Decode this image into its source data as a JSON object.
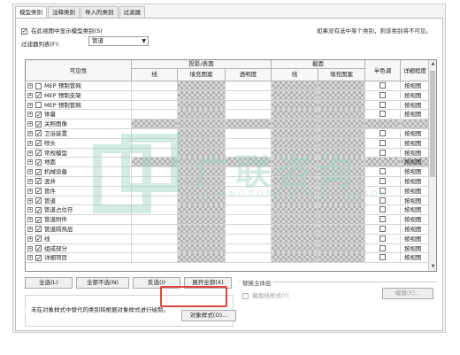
{
  "tabs": [
    {
      "label": "模型类别",
      "active": true
    },
    {
      "label": "注释类别",
      "active": false
    },
    {
      "label": "导入的类别",
      "active": false
    },
    {
      "label": "过滤器",
      "active": false
    }
  ],
  "show_all_checkbox": {
    "label": "在此视图中显示模型类别(S)",
    "checked": true
  },
  "note": "如果没有选中某个类别，则该类别将不可见。",
  "filter": {
    "label": "过滤器列表(F):",
    "value": "管道"
  },
  "table": {
    "headers": {
      "visibility": "可见性",
      "projection_surface": "投影/表面",
      "cut": "截面",
      "halftone": "半色调",
      "detail_level": "详细程度",
      "lines": "线",
      "fill_pattern": "填充图案",
      "transparency": "透明度",
      "cut_lines": "线",
      "cut_fill_pattern": "填充图案"
    },
    "rows": [
      {
        "name": "MEP 预制管网",
        "checked": false,
        "patterned": false,
        "detail": "按视图"
      },
      {
        "name": "MEP 预制支架",
        "checked": true,
        "patterned": false,
        "detail": "按视图"
      },
      {
        "name": "MEP 预制管网",
        "checked": false,
        "patterned": false,
        "detail": "按视图"
      },
      {
        "name": "体量",
        "checked": true,
        "patterned": false,
        "detail": "按视图"
      },
      {
        "name": "关照图像",
        "checked": true,
        "patterned": true,
        "detail": ""
      },
      {
        "name": "卫浴装置",
        "checked": true,
        "patterned": false,
        "detail": "按视图"
      },
      {
        "name": "喷头",
        "checked": true,
        "patterned": false,
        "detail": "按视图"
      },
      {
        "name": "常规模型",
        "checked": true,
        "patterned": false,
        "detail": "按视图"
      },
      {
        "name": "地面",
        "checked": true,
        "patterned": true,
        "detail": "按视图"
      },
      {
        "name": "机械设备",
        "checked": true,
        "patterned": false,
        "detail": "按视图"
      },
      {
        "name": "竖井",
        "checked": true,
        "patterned": false,
        "detail": "按视图"
      },
      {
        "name": "管件",
        "checked": true,
        "patterned": false,
        "detail": "按视图"
      },
      {
        "name": "管道",
        "checked": true,
        "patterned": false,
        "detail": "按视图"
      },
      {
        "name": "管道占位符",
        "checked": true,
        "patterned": false,
        "detail": "按视图"
      },
      {
        "name": "管道附件",
        "checked": true,
        "patterned": false,
        "detail": "按视图"
      },
      {
        "name": "管道隔热层",
        "checked": true,
        "patterned": false,
        "detail": "按视图"
      },
      {
        "name": "线",
        "checked": true,
        "patterned": false,
        "detail": "按视图"
      },
      {
        "name": "组成部分",
        "checked": true,
        "patterned": false,
        "detail": "按视图"
      },
      {
        "name": "详细项目",
        "checked": true,
        "patterned": false,
        "detail": "按视图"
      }
    ]
  },
  "buttons": {
    "select_all": "全选(L)",
    "select_none": "全部不选(N)",
    "invert": "反选(I)",
    "expand_all": "展开全部(X)",
    "object_styles": "对象样式(O)..."
  },
  "override_group": {
    "title": "替换主体层",
    "cut_line_style_label": "截面线样式(Y)",
    "edit_button": "编辑(E)..."
  },
  "bottom_text": "未在对象样式中替代的类别将根据对象样式进行绘制。",
  "watermark": {
    "text": "广联咨询",
    "sub": "GUANGZONG CONSULTATION"
  },
  "colors": {
    "highlight": "#e0443a",
    "watermark": "#9fd3c4"
  }
}
